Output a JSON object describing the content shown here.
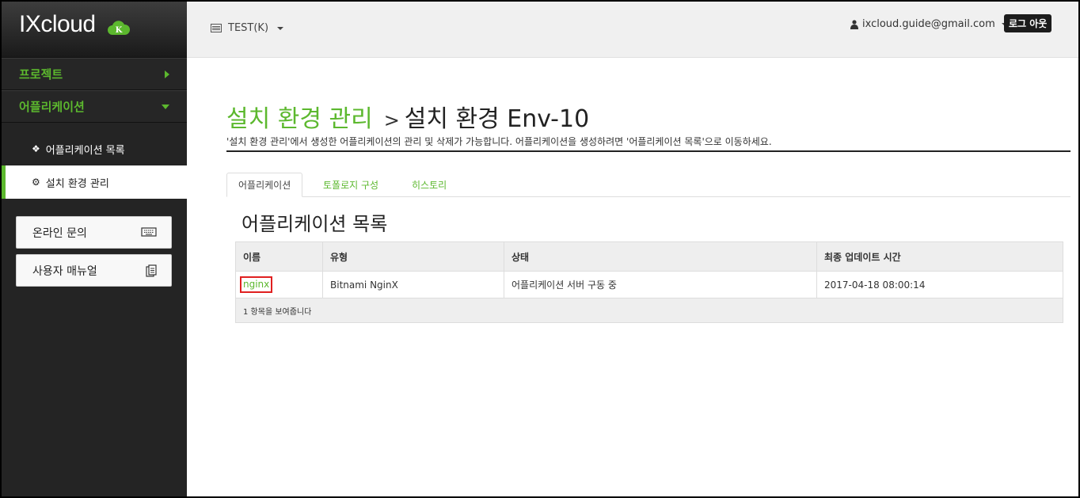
{
  "brand": {
    "name": "IXcloud",
    "badge": "K"
  },
  "sidebar": {
    "project": "프로젝트",
    "application": "어플리케이션",
    "sub_items": [
      {
        "label": "어플리케이션 목록"
      },
      {
        "label": "설치 환경 관리"
      }
    ],
    "buttons": [
      {
        "label": "온라인 문의"
      },
      {
        "label": "사용자 매뉴얼"
      }
    ]
  },
  "header": {
    "project_selector": "TEST(K)",
    "user_email": "ixcloud.guide@gmail.com",
    "logout": "로그 아웃"
  },
  "page": {
    "title_link": "설치 환경 관리",
    "separator": ">",
    "title_current": "설치 환경 Env-10",
    "description": "'설치 환경 관리'에서 생성한 어플리케이션의 관리 및 삭제가 가능합니다. 어플리케이션을 생성하려면 '어플리케이션 목록'으로 이동하세요."
  },
  "tabs": [
    {
      "label": "어플리케이션"
    },
    {
      "label": "토폴로지 구성"
    },
    {
      "label": "히스토리"
    }
  ],
  "section_title": "어플리케이션 목록",
  "table": {
    "headers": [
      "이름",
      "유형",
      "상태",
      "최종 업데이트 시간"
    ],
    "rows": [
      {
        "name": "nginx",
        "type": "Bitnami NginX",
        "status": "어플리케이션 서버 구동 중",
        "updated": "2017-04-18 08:00:14"
      }
    ],
    "footer": "1 항목을 보여줍니다"
  },
  "colors": {
    "accent": "#5cb82e",
    "sidebar": "#242424",
    "highlight": "#e02020"
  }
}
